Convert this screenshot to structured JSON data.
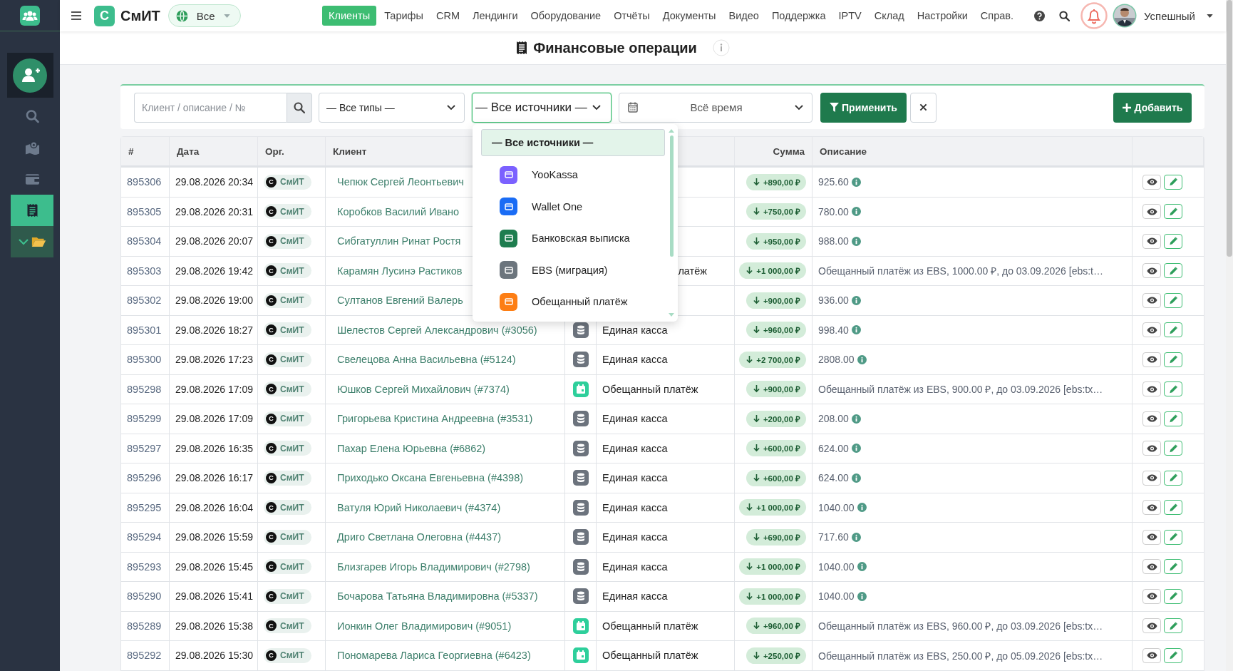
{
  "sidebar": {
    "items": [
      {
        "kind": "add",
        "selected": false
      },
      {
        "kind": "search",
        "selected": false
      },
      {
        "kind": "map",
        "selected": false
      },
      {
        "kind": "wallet",
        "selected": false
      },
      {
        "kind": "receipt",
        "selected": true
      },
      {
        "kind": "folder",
        "selected": false,
        "expanded": true
      }
    ]
  },
  "topbar": {
    "logo": {
      "letter": "С",
      "name": "СмИТ"
    },
    "scope": {
      "label": "Все"
    },
    "nav": [
      {
        "label": "Клиенты",
        "selected": true
      },
      {
        "label": "Тарифы",
        "selected": false
      },
      {
        "label": "CRM",
        "selected": false
      },
      {
        "label": "Лендинги",
        "selected": false
      },
      {
        "label": "Оборудование",
        "selected": false
      },
      {
        "label": "Отчёты",
        "selected": false
      },
      {
        "label": "Документы",
        "selected": false
      },
      {
        "label": "Видео",
        "selected": false
      },
      {
        "label": "Поддержка",
        "selected": false
      },
      {
        "label": "IPTV",
        "selected": false
      },
      {
        "label": "Склад",
        "selected": false
      },
      {
        "label": "Настройки",
        "selected": false
      },
      {
        "label": "Справ.",
        "selected": false
      }
    ],
    "user": {
      "name": "Успешный"
    }
  },
  "page": {
    "title": "Финансовые операции"
  },
  "filters": {
    "search": {
      "placeholder": "Клиент / описание / №"
    },
    "type": {
      "value": "— Все типы —"
    },
    "source": {
      "value": "— Все источники —",
      "expanded": true,
      "options": [
        {
          "label": "— Все источники —",
          "selected": true
        },
        {
          "label": "YooKassa",
          "selected": false,
          "color": "#7b61ff"
        },
        {
          "label": "Wallet One",
          "selected": false,
          "color": "#1a6cf5"
        },
        {
          "label": "Банковская выписка",
          "selected": false,
          "color": "#1e7d4f"
        },
        {
          "label": "EBS (миграция)",
          "selected": false,
          "color": "#6c757d"
        },
        {
          "label": "Обещанный платёж",
          "selected": false,
          "color": "#fd7e14"
        }
      ]
    },
    "period": {
      "value": "Всё время"
    },
    "apply": "Применить",
    "add": "Добавить"
  },
  "table": {
    "header": {
      "id": "#",
      "date": "Дата",
      "org": "Орг.",
      "client": "Клиент",
      "amount": "Сумма",
      "description": "Описание"
    },
    "rows": [
      {
        "id": "895306",
        "date": "29.08.2026 20:34",
        "org_letter": "С",
        "org": "СмИТ",
        "client": "Чепюк Сергей Леонтьевич",
        "amount": "+890,00 ₽",
        "description": "925.60",
        "info": true
      },
      {
        "id": "895305",
        "date": "29.08.2026 20:31",
        "org_letter": "С",
        "org": "СмИТ",
        "client": "Коробков Василий Ивано",
        "amount": "+750,00 ₽",
        "description": "780.00",
        "info": true
      },
      {
        "id": "895304",
        "date": "29.08.2026 20:07",
        "org_letter": "С",
        "org": "СмИТ",
        "client": "Сибгатуллин Ринат Ростя",
        "amount": "+950,00 ₽",
        "description": "988.00",
        "info": true
      },
      {
        "id": "895303",
        "date": "29.08.2026 19:42",
        "org_letter": "С",
        "org": "СмИТ",
        "client": "Карамян Лусинэ Растиков",
        "source": "латёж",
        "amount": "+1 000,00 ₽",
        "description": "Обещанный платёж из EBS, 1000.00 ₽, до 03.09.2026 [ebs:t…",
        "info": false
      },
      {
        "id": "895302",
        "date": "29.08.2026 19:00",
        "org_letter": "С",
        "org": "СмИТ",
        "client": "Султанов Евгений Валерь",
        "amount": "+900,00 ₽",
        "description": "936.00",
        "info": true
      },
      {
        "id": "895301",
        "date": "29.08.2026 18:27",
        "org_letter": "С",
        "org": "СмИТ",
        "client": "Шелестов Сергей Александрович (#3056)",
        "kind": "cash",
        "source": "Единая касса",
        "amount": "+960,00 ₽",
        "description": "998.40",
        "info": true
      },
      {
        "id": "895300",
        "date": "29.08.2026 17:23",
        "org_letter": "С",
        "org": "СмИТ",
        "client": "Свелецова Анна Васильевна (#5124)",
        "kind": "cash",
        "source": "Единая касса",
        "amount": "+2 700,00 ₽",
        "description": "2808.00",
        "info": true
      },
      {
        "id": "895298",
        "date": "29.08.2026 17:09",
        "org_letter": "С",
        "org": "СмИТ",
        "client": "Юшков Сергей Михайлович (#7374)",
        "kind": "promise",
        "source": "Обещанный платёж",
        "amount": "+900,00 ₽",
        "description": "Обещанный платёж из EBS, 900.00 ₽, до 03.09.2026 [ebs:tx…",
        "info": false
      },
      {
        "id": "895299",
        "date": "29.08.2026 17:09",
        "org_letter": "С",
        "org": "СмИТ",
        "client": "Григорьева Кристина Андреевна (#3531)",
        "kind": "cash",
        "source": "Единая касса",
        "amount": "+200,00 ₽",
        "description": "208.00",
        "info": true
      },
      {
        "id": "895297",
        "date": "29.08.2026 16:35",
        "org_letter": "С",
        "org": "СмИТ",
        "client": "Пахар Елена Юрьевна (#6862)",
        "kind": "cash",
        "source": "Единая касса",
        "amount": "+600,00 ₽",
        "description": "624.00",
        "info": true
      },
      {
        "id": "895296",
        "date": "29.08.2026 16:17",
        "org_letter": "С",
        "org": "СмИТ",
        "client": "Приходько Оксана Евгеньевна (#4398)",
        "kind": "cash",
        "source": "Единая касса",
        "amount": "+600,00 ₽",
        "description": "624.00",
        "info": true
      },
      {
        "id": "895295",
        "date": "29.08.2026 16:04",
        "org_letter": "С",
        "org": "СмИТ",
        "client": "Ватуля Юрий Николаевич (#4374)",
        "kind": "cash",
        "source": "Единая касса",
        "amount": "+1 000,00 ₽",
        "description": "1040.00",
        "info": true
      },
      {
        "id": "895294",
        "date": "29.08.2026 15:59",
        "org_letter": "С",
        "org": "СмИТ",
        "client": "Дриго Светлана Олеговна (#4437)",
        "kind": "cash",
        "source": "Единая касса",
        "amount": "+690,00 ₽",
        "description": "717.60",
        "info": true
      },
      {
        "id": "895293",
        "date": "29.08.2026 15:45",
        "org_letter": "С",
        "org": "СмИТ",
        "client": "Близгарев Игорь Владимирович (#2798)",
        "kind": "cash",
        "source": "Единая касса",
        "amount": "+1 000,00 ₽",
        "description": "1040.00",
        "info": true
      },
      {
        "id": "895290",
        "date": "29.08.2026 15:41",
        "org_letter": "С",
        "org": "СмИТ",
        "client": "Бочарова Татьяна Владимировна (#5337)",
        "kind": "cash",
        "source": "Единая касса",
        "amount": "+1 000,00 ₽",
        "description": "1040.00",
        "info": true
      },
      {
        "id": "895289",
        "date": "29.08.2026 15:38",
        "org_letter": "С",
        "org": "СмИТ",
        "client": "Ионкин Олег Владимирович (#9051)",
        "kind": "promise",
        "source": "Обещанный платёж",
        "amount": "+960,00 ₽",
        "description": "Обещанный платёж из EBS, 960.00 ₽, до 03.09.2026 [ebs:tx…",
        "info": false
      },
      {
        "id": "895292",
        "date": "29.08.2026 15:30",
        "org_letter": "С",
        "org": "СмИТ",
        "client": "Пономарева Лариса Георгиевна (#6423)",
        "kind": "promise",
        "source": "Обещанный платёж",
        "amount": "+250,00 ₽",
        "description": "Обещанный платёж из EBS, 250.00 ₽, до 05.09.2026 [ebs:tx…",
        "info": false
      }
    ]
  }
}
